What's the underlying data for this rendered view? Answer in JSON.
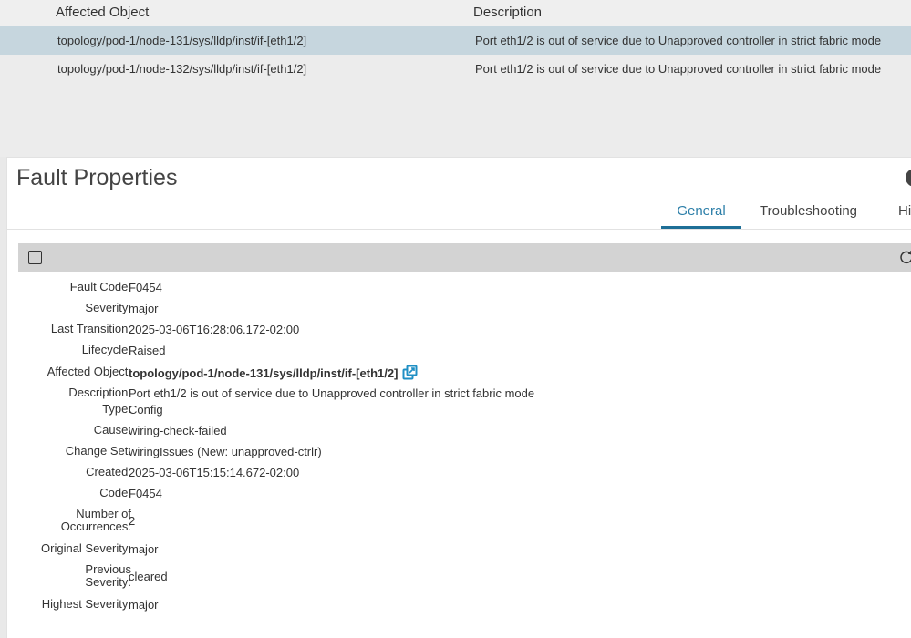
{
  "table": {
    "headers": [
      "Affected Object",
      "Description"
    ],
    "rows": [
      {
        "object": "topology/pod-1/node-131/sys/lldp/inst/if-[eth1/2]",
        "description": "Port eth1/2 is out of service due to Unapproved controller in strict fabric mode",
        "selected": true
      },
      {
        "object": "topology/pod-1/node-132/sys/lldp/inst/if-[eth1/2]",
        "description": "Port eth1/2 is out of service due to Unapproved controller in strict fabric mode",
        "selected": false
      }
    ]
  },
  "panel": {
    "title": "Fault Properties",
    "tabs": [
      "General",
      "Troubleshooting",
      "Hi"
    ],
    "active_tab": "General"
  },
  "properties": {
    "fault_code": {
      "label": "Fault Code:",
      "value": "F0454"
    },
    "severity": {
      "label": "Severity:",
      "value": "major"
    },
    "last_transition": {
      "label": "Last Transition:",
      "value": "2025-03-06T16:28:06.172-02:00"
    },
    "lifecycle": {
      "label": "Lifecycle:",
      "value": "Raised"
    },
    "affected_object": {
      "label": "Affected Object:",
      "value": "topology/pod-1/node-131/sys/lldp/inst/if-[eth1/2]"
    },
    "description": {
      "label": "Description:",
      "value": "Port eth1/2 is out of service due to Unapproved controller in strict fabric mode"
    },
    "type": {
      "label": "Type:",
      "value": "Config"
    },
    "cause": {
      "label": "Cause:",
      "value": "wiring-check-failed"
    },
    "change_set": {
      "label": "Change Set:",
      "value": "wiringIssues (New: unapproved-ctrlr)"
    },
    "created": {
      "label": "Created:",
      "value": "2025-03-06T15:15:14.672-02:00"
    },
    "code": {
      "label": "Code:",
      "value": "F0454"
    },
    "occurrences": {
      "label_line1": "Number of",
      "label_line2": "Occurrences:",
      "value": "2"
    },
    "original_severity": {
      "label": "Original Severity:",
      "value": "major"
    },
    "previous_severity": {
      "label_line1": "Previous",
      "label_line2": "Severity:",
      "value": "cleared"
    },
    "highest_severity": {
      "label": "Highest Severity:",
      "value": "major"
    }
  },
  "colors": {
    "accent": "#1e6f97",
    "selected_row": "#c6d6de",
    "toolbar": "#d3d3d3",
    "link_icon": "#1f8fc4"
  },
  "icons": {
    "external_link": "external-link-icon",
    "refresh": "refresh-icon",
    "checkbox": "checkbox-icon",
    "close": "close-icon"
  }
}
